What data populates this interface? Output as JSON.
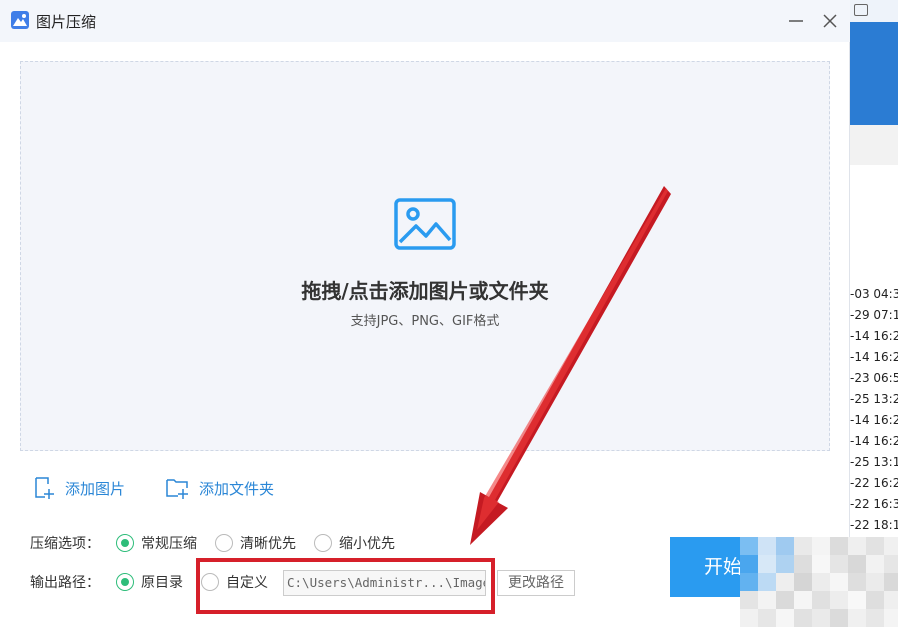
{
  "window": {
    "title": "图片压缩",
    "minimize_label": "minimize",
    "close_label": "close"
  },
  "dropzone": {
    "title": "拖拽/点击添加图片或文件夹",
    "subtitle": "支持JPG、PNG、GIF格式"
  },
  "actions": {
    "add_images": "添加图片",
    "add_folder": "添加文件夹"
  },
  "compression": {
    "label": "压缩选项：",
    "options": [
      {
        "label": "常规压缩",
        "selected": true
      },
      {
        "label": "清晰优先",
        "selected": false
      },
      {
        "label": "缩小优先",
        "selected": false
      }
    ]
  },
  "output": {
    "label": "输出路径：",
    "options": [
      {
        "label": "原目录",
        "selected": true
      },
      {
        "label": "自定义",
        "selected": false
      }
    ],
    "path_value": "C:\\Users\\Administr...\\Image",
    "change_path_label": "更改路径"
  },
  "start_label": "开始",
  "background_rows": [
    "-03 04:3",
    "-29 07:1",
    "-14 16:2",
    "-14 16:2",
    "-23 06:5",
    "-25 13:2",
    "-14 16:2",
    "-14 16:2",
    "-25 13:1",
    "-22 16:2",
    "-22 16:3",
    "-22 18:1"
  ],
  "colors": {
    "accent": "#2a9bf0",
    "radio_on": "#2ebd7a",
    "link": "#2a86d6",
    "highlight": "#d6202a"
  }
}
